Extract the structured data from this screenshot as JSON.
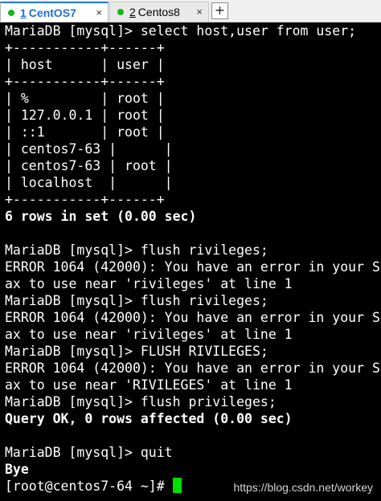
{
  "tabs": [
    {
      "number": "1",
      "title": "CentOS7",
      "close": "×"
    },
    {
      "number": "2",
      "title": "Centos8",
      "close": "×"
    }
  ],
  "new_tab": "+",
  "terminal": {
    "lines": [
      "MariaDB [mysql]> select host,user from user;",
      "+-----------+------+",
      "| host      | user |",
      "+-----------+------+",
      "| %         | root |",
      "| 127.0.0.1 | root |",
      "| ::1       | root |",
      "| centos7-63 |      |",
      "| centos7-63 | root |",
      "| localhost  |      |",
      "+-----------+------+",
      "6 rows in set (0.00 sec)",
      "",
      "MariaDB [mysql]> flush rivileges;",
      "ERROR 1064 (42000): You have an error in your S",
      "ax to use near 'rivileges' at line 1",
      "MariaDB [mysql]> flush rivileges;",
      "ERROR 1064 (42000): You have an error in your S",
      "ax to use near 'rivileges' at line 1",
      "MariaDB [mysql]> FLUSH RIVILEGES;",
      "ERROR 1064 (42000): You have an error in your S",
      "ax to use near 'RIVILEGES' at line 1",
      "MariaDB [mysql]> flush privileges;",
      "Query OK, 0 rows affected (0.00 sec)",
      "",
      "MariaDB [mysql]> quit",
      "Bye"
    ],
    "prompt": "[root@centos7-64 ~]# "
  },
  "watermark": "https://blog.csdn.net/workey",
  "colors": {
    "cursor": "#00e000",
    "active_tab_accent": "#1e6fd9",
    "status_dot": "#18b618"
  }
}
